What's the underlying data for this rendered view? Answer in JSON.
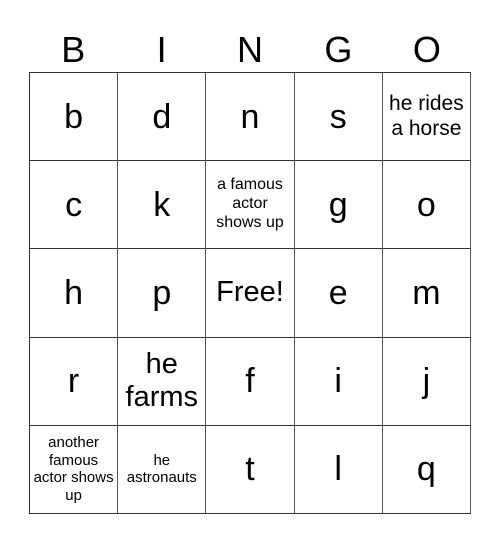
{
  "header": [
    "B",
    "I",
    "N",
    "G",
    "O"
  ],
  "cells": [
    [
      "b",
      "d",
      "n",
      "s",
      "he rides a horse"
    ],
    [
      "c",
      "k",
      "a famous actor shows up",
      "g",
      "o"
    ],
    [
      "h",
      "p",
      "Free!",
      "e",
      "m"
    ],
    [
      "r",
      "he farms",
      "f",
      "i",
      "j"
    ],
    [
      "another famous actor shows up",
      "he astronauts",
      "t",
      "l",
      "q"
    ]
  ]
}
